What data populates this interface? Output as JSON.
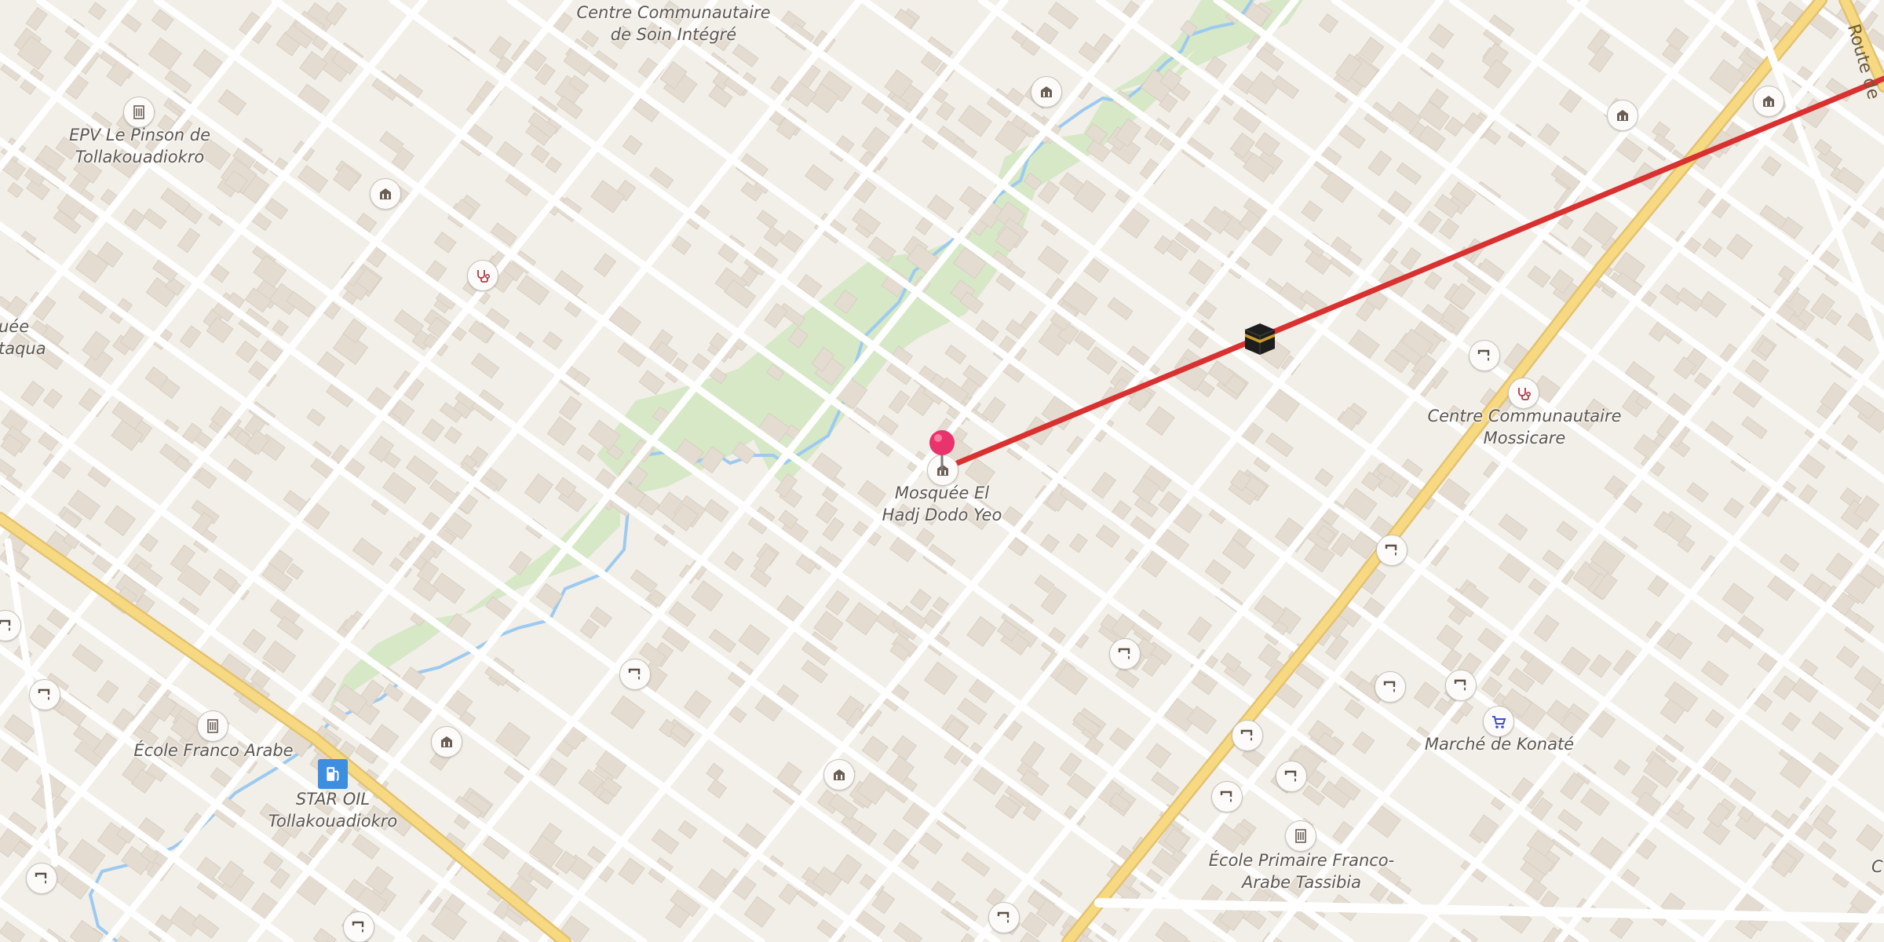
{
  "map": {
    "labels": {
      "centre_soin": [
        "Centre Communautaire",
        "de Soin Intégré"
      ],
      "epv": [
        "EPV Le Pinson de",
        "Tollakouadiokro"
      ],
      "mosquee_partial": [
        "uée",
        "taqua"
      ],
      "mosquee_el_hadj": [
        "Mosquée El",
        "Hadj Dodo Yeo"
      ],
      "centre_mossicare": [
        "Centre Communautaire",
        "Mossicare"
      ],
      "ecole_franco_arabe": "École Franco Arabe",
      "star_oil": [
        "STAR OIL",
        "Tollakouadiokro"
      ],
      "marche_konate": "Marché de Konaté",
      "ecole_primaire": [
        "École Primaire Franco-",
        "Arabe Tassibia"
      ],
      "edge_right": "C",
      "route_partial": "Route de"
    },
    "colors": {
      "background": "#f2efe9",
      "building": "#e4dcd1",
      "road": "#ffffff",
      "primary_road": "#f5d47a",
      "park": "#d6e8c6",
      "water": "#9ccaf0",
      "route_line": "#d93030",
      "pin": "#e8336d"
    },
    "pois": [
      {
        "kind": "school-icon"
      },
      {
        "kind": "bank-icon"
      },
      {
        "kind": "doctor-icon"
      },
      {
        "kind": "bank-icon"
      },
      {
        "kind": "bank-icon"
      },
      {
        "kind": "bank-icon"
      },
      {
        "kind": "doctor-icon"
      },
      {
        "kind": "water-tap-icon"
      },
      {
        "kind": "school-icon"
      },
      {
        "kind": "fuel-icon"
      },
      {
        "kind": "marketplace-icon"
      },
      {
        "kind": "mosque-icon"
      },
      {
        "kind": "kaaba-icon"
      },
      {
        "kind": "location-pin-icon"
      }
    ]
  }
}
